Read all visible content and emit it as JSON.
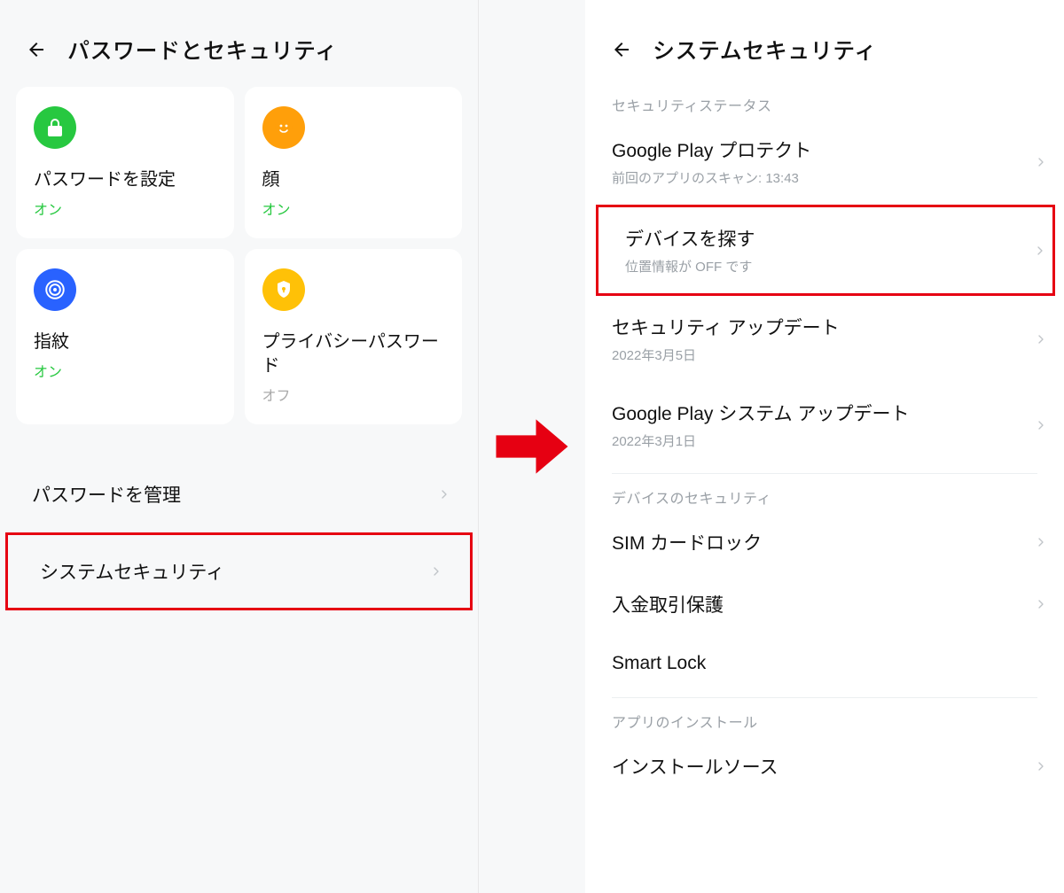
{
  "left": {
    "title": "パスワードとセキュリティ",
    "cards": [
      {
        "title": "パスワードを設定",
        "status": "オン",
        "status_on": true,
        "icon": "lock-icon",
        "icon_color": "green"
      },
      {
        "title": "顔",
        "status": "オン",
        "status_on": true,
        "icon": "face-icon",
        "icon_color": "orange"
      },
      {
        "title": "指紋",
        "status": "オン",
        "status_on": true,
        "icon": "fingerprint-icon",
        "icon_color": "blue"
      },
      {
        "title": "プライバシーパスワード",
        "status": "オフ",
        "status_on": false,
        "icon": "shield-icon",
        "icon_color": "yellow"
      }
    ],
    "rows": [
      {
        "label": "パスワードを管理",
        "highlighted": false,
        "has_chevron": true
      },
      {
        "label": "システムセキュリティ",
        "highlighted": true,
        "has_chevron": true
      }
    ]
  },
  "right": {
    "title": "システムセキュリティ",
    "sections": [
      {
        "label": "セキュリティステータス",
        "items": [
          {
            "title": "Google Play プロテクト",
            "sub": "前回のアプリのスキャン: 13:43",
            "highlighted": false,
            "has_chevron": true
          },
          {
            "title": "デバイスを探す",
            "sub": "位置情報が OFF です",
            "highlighted": true,
            "has_chevron": true
          },
          {
            "title": "セキュリティ アップデート",
            "sub": "2022年3月5日",
            "highlighted": false,
            "has_chevron": true
          },
          {
            "title": "Google Play システム アップデート",
            "sub": "2022年3月1日",
            "highlighted": false,
            "has_chevron": true
          }
        ]
      },
      {
        "label": "デバイスのセキュリティ",
        "items": [
          {
            "title": "SIM カードロック",
            "sub": "",
            "highlighted": false,
            "has_chevron": true
          },
          {
            "title": "入金取引保護",
            "sub": "",
            "highlighted": false,
            "has_chevron": true
          },
          {
            "title": "Smart Lock",
            "sub": "",
            "highlighted": false,
            "has_chevron": false
          }
        ]
      },
      {
        "label": "アプリのインストール",
        "items": [
          {
            "title": "インストールソース",
            "sub": "",
            "highlighted": false,
            "has_chevron": true
          }
        ]
      }
    ]
  },
  "colors": {
    "highlight": "#e60012",
    "on": "#27c840",
    "off": "#aaaaaa"
  }
}
